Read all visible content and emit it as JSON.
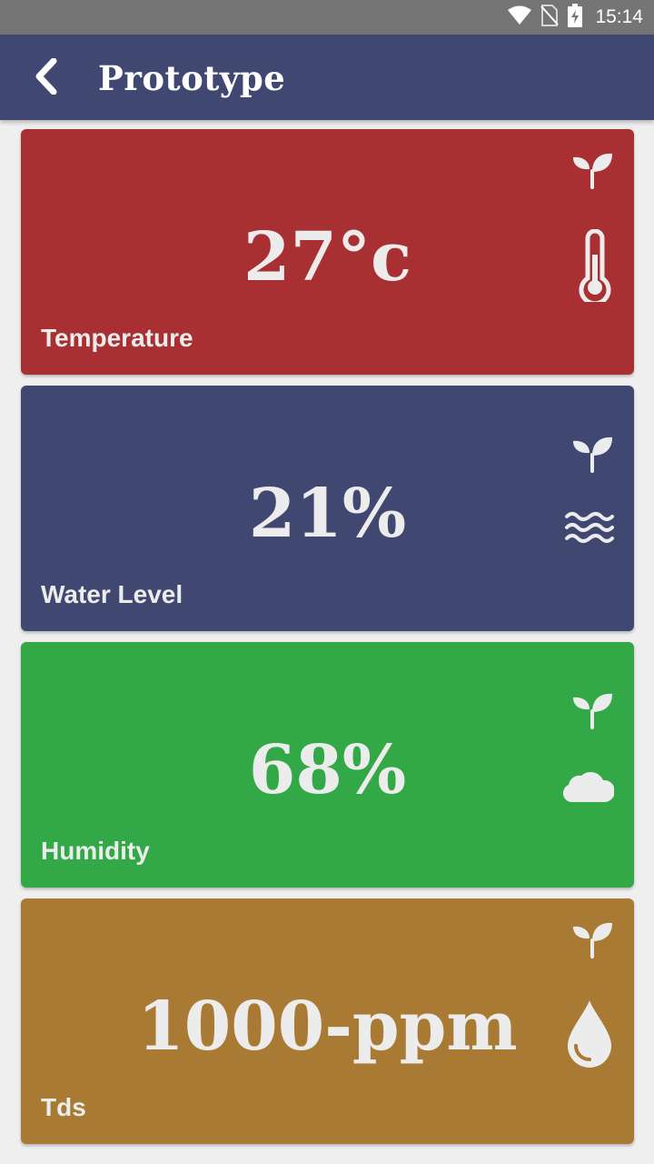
{
  "status_bar": {
    "time": "15:14",
    "icons": [
      "wifi-icon",
      "no-sim-icon",
      "battery-charging-icon"
    ]
  },
  "app_bar": {
    "title": "Prototype",
    "back_icon": "chevron-left-icon"
  },
  "cards": [
    {
      "value": "27°c",
      "label": "Temperature",
      "color": "#a83032",
      "icon": "thermometer-icon"
    },
    {
      "value": "21%",
      "label": "Water Level",
      "color": "#404872",
      "icon": "water-waves-icon"
    },
    {
      "value": "68%",
      "label": "Humidity",
      "color": "#33a846",
      "icon": "cloud-icon"
    },
    {
      "value": "1000-ppm",
      "label": "Tds",
      "color": "#a87a33",
      "icon": "water-drop-icon"
    }
  ],
  "colors": {
    "app_bar": "#404872",
    "status_bar": "#757575",
    "background": "#efefef",
    "card_text": "#ececec"
  }
}
